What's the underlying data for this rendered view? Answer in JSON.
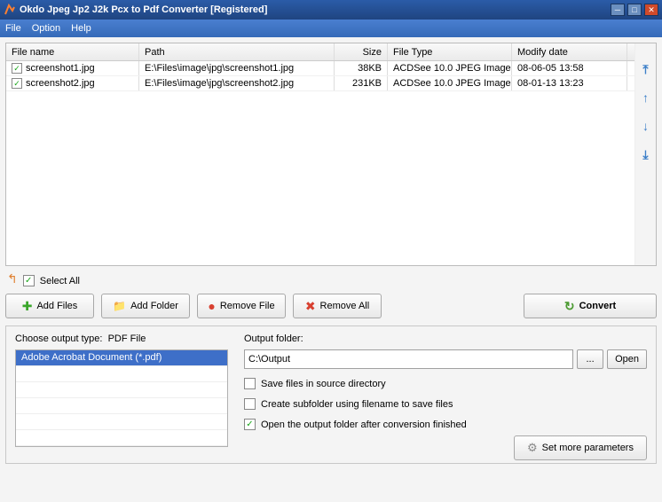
{
  "window": {
    "title": "Okdo Jpeg Jp2 J2k Pcx to Pdf Converter [Registered]"
  },
  "menu": {
    "file": "File",
    "option": "Option",
    "help": "Help"
  },
  "columns": {
    "filename": "File name",
    "path": "Path",
    "size": "Size",
    "filetype": "File Type",
    "modify": "Modify date"
  },
  "rows": [
    {
      "checked": true,
      "name": "screenshot1.jpg",
      "path": "E:\\Files\\image\\jpg\\screenshot1.jpg",
      "size": "38KB",
      "type": "ACDSee 10.0 JPEG Image",
      "date": "08-06-05 13:58"
    },
    {
      "checked": true,
      "name": "screenshot2.jpg",
      "path": "E:\\Files\\image\\jpg\\screenshot2.jpg",
      "size": "231KB",
      "type": "ACDSee 10.0 JPEG Image",
      "date": "08-01-13 13:23"
    }
  ],
  "selectAll": {
    "label": "Select All",
    "checked": true
  },
  "buttons": {
    "addFiles": "Add Files",
    "addFolder": "Add Folder",
    "removeFile": "Remove File",
    "removeAll": "Remove All",
    "convert": "Convert"
  },
  "output": {
    "chooseLabel": "Choose output type:",
    "typeLabel": "PDF File",
    "listItem": "Adobe Acrobat Document (*.pdf)",
    "folderLabel": "Output folder:",
    "folderValue": "C:\\Output",
    "browse": "...",
    "open": "Open",
    "chk1": {
      "label": "Save files in source directory",
      "checked": false
    },
    "chk2": {
      "label": "Create subfolder using filename to save files",
      "checked": false
    },
    "chk3": {
      "label": "Open the output folder after conversion finished",
      "checked": true
    },
    "setMore": "Set more parameters"
  }
}
